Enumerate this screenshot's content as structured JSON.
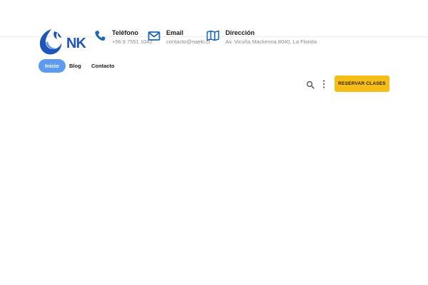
{
  "brand": {
    "logo_text": "NK",
    "logo_icon": "phoenix-logo-icon",
    "color": "#1f54b8"
  },
  "contact": {
    "phone": {
      "icon": "phone-icon",
      "title": "Teléfono",
      "value": "+56 9 7551 1042"
    },
    "email": {
      "icon": "envelope-icon",
      "title": "Email",
      "value": "contacto@naeki.cl"
    },
    "address": {
      "icon": "map-icon",
      "title": "Dirección",
      "value": "Av. Vicuña Mackenna 8040, La Florida"
    }
  },
  "nav": {
    "items": [
      {
        "label": "Inicio",
        "active": true
      },
      {
        "label": "Blog",
        "active": false
      },
      {
        "label": "Contacto",
        "active": false
      }
    ]
  },
  "toolbar": {
    "search_icon": "search-icon",
    "menu_icon": "kebab-menu-icon",
    "cta_label": "RESERVAR CLASES"
  },
  "colors": {
    "accent": "#1f54b8",
    "nav_active_bg": "#5e9bf0",
    "cta_bg": "#f5bd16"
  }
}
